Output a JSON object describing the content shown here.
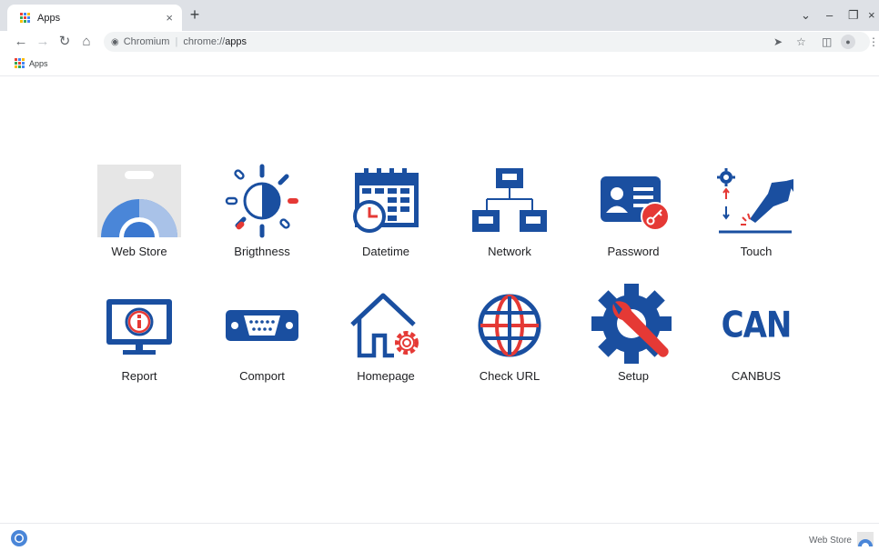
{
  "browser": {
    "tab_title": "Apps",
    "new_tab": "+",
    "close": "×",
    "site_label": "Chromium",
    "url_scheme": "chrome://",
    "url_path": "apps",
    "bookmark": "Apps"
  },
  "apps": [
    {
      "label": "Web Store",
      "icon": "web-store-icon"
    },
    {
      "label": "Brigthness",
      "icon": "brightness-icon"
    },
    {
      "label": "Datetime",
      "icon": "calendar-clock-icon"
    },
    {
      "label": "Network",
      "icon": "network-icon"
    },
    {
      "label": "Password",
      "icon": "id-card-key-icon"
    },
    {
      "label": "Touch",
      "icon": "touch-hand-icon"
    },
    {
      "label": "Report",
      "icon": "monitor-info-icon"
    },
    {
      "label": "Comport",
      "icon": "serial-port-icon"
    },
    {
      "label": "Homepage",
      "icon": "house-gear-icon"
    },
    {
      "label": "Check URL",
      "icon": "globe-icon"
    },
    {
      "label": "Setup",
      "icon": "gear-wrench-icon"
    },
    {
      "label": "CANBUS",
      "icon": "can-icon",
      "text": "CAN"
    }
  ],
  "footer": {
    "web_store": "Web Store"
  },
  "colors": {
    "blue": "#1a4fa0",
    "red": "#e53935",
    "chrome_blue": "#4a86d8"
  }
}
